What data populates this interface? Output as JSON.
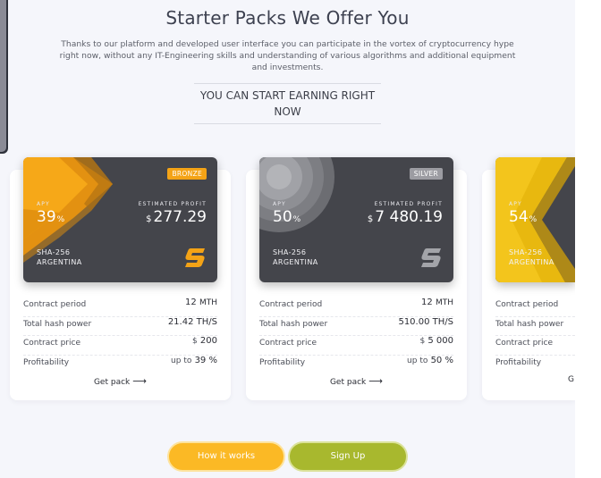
{
  "section": {
    "title": "Starter Packs We Offer You",
    "intro": "Thanks to our platform and developed user interface you can participate in the vortex of cryptocurrency hype right now, without any IT-Engineering skills and understanding of various algorithms and additional equipment and investments.",
    "cta_line1": "YOU CAN START EARNING RIGHT",
    "cta_line2": "NOW"
  },
  "packs": [
    {
      "tier": "BRONZE",
      "apy_label": "APY",
      "apy": "39",
      "apy_unit": "%",
      "est_label": "ESTIMATED PROFIT",
      "est_currency": "$",
      "est_value": "277.29",
      "algo_line1": "SHA-256",
      "algo_line2": "ARGENTINA",
      "logo_icon": "s-logo-icon",
      "color": "#f4a316",
      "specs": [
        {
          "label": "Contract period",
          "value": "12",
          "unit": "MTH",
          "prefix": ""
        },
        {
          "label": "Total hash power",
          "value": "21.42",
          "unit": "TH/S",
          "prefix": ""
        },
        {
          "label": "Contract price",
          "value": "200",
          "unit": "",
          "prefix": "$"
        },
        {
          "label": "Profitability",
          "value": "39",
          "unit": "%",
          "prefix": "up to"
        }
      ],
      "action": "Get pack"
    },
    {
      "tier": "SILVER",
      "apy_label": "APY",
      "apy": "50",
      "apy_unit": "%",
      "est_label": "ESTIMATED PROFIT",
      "est_currency": "$",
      "est_value": "7 480.19",
      "algo_line1": "SHA-256",
      "algo_line2": "ARGENTINA",
      "logo_icon": "s-logo-icon",
      "color": "#9c9ca2",
      "specs": [
        {
          "label": "Contract period",
          "value": "12",
          "unit": "MTH",
          "prefix": ""
        },
        {
          "label": "Total hash power",
          "value": "510.00",
          "unit": "TH/S",
          "prefix": ""
        },
        {
          "label": "Contract price",
          "value": "5 000",
          "unit": "",
          "prefix": "$"
        },
        {
          "label": "Profitability",
          "value": "50",
          "unit": "%",
          "prefix": "up to"
        }
      ],
      "action": "Get pack"
    },
    {
      "tier": "",
      "apy_label": "APY",
      "apy": "54",
      "apy_unit": "%",
      "algo_line1": "SHA-256",
      "algo_line2": "ARGENTINA",
      "color": "#e8b80f",
      "specs": [
        {
          "label": "Contract period"
        },
        {
          "label": "Total hash power"
        },
        {
          "label": "Contract price"
        },
        {
          "label": "Profitability"
        }
      ],
      "action": "G"
    }
  ],
  "buttons": {
    "how": "How it works",
    "signup": "Sign Up"
  },
  "colors": {
    "how_button": "#fbb925",
    "signup_button": "#a8b82e",
    "card_dark": "#44454b"
  }
}
